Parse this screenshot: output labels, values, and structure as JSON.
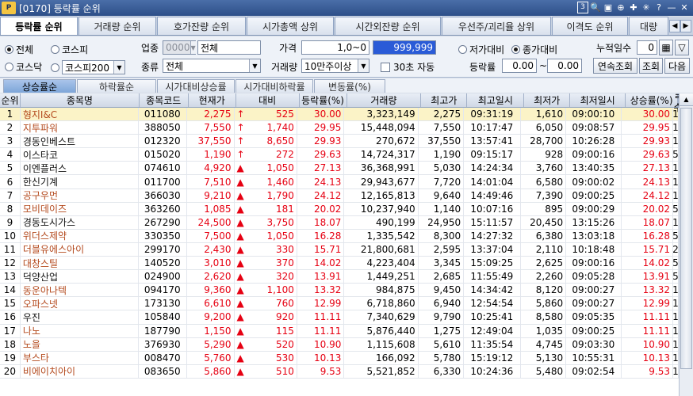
{
  "window": {
    "code": "[0170]",
    "title": "등락률 순위",
    "logo": "P"
  },
  "title_controls": [
    "3",
    "🔍",
    "▣",
    "⊕",
    "✚",
    "✳",
    "?",
    "—",
    "✕"
  ],
  "tabs": [
    "등락률 순위",
    "거래량 순위",
    "호가잔량 순위",
    "시가총액 상위",
    "시간외잔량 순위",
    "우선주/괴리율 상위",
    "이격도 순위",
    "대량"
  ],
  "filters": {
    "market_all": "전체",
    "kospi": "코스피",
    "kosdaq": "코스닥",
    "kospi200": "코스피200",
    "industry_label": "업종",
    "industry_code": "0000",
    "industry_name": "전체",
    "type_label": "종류",
    "type_value": "전체",
    "price_label": "가격",
    "price_from": "1,0~0",
    "price_to": "999,999",
    "volume_label": "거래량",
    "volume_value": "10만주이상",
    "auto30_label": "30초 자동",
    "vs_low": "저가대비",
    "vs_close": "종가대비",
    "rate_label": "등락률",
    "rate_from": "0.00",
    "rate_sep": "~",
    "rate_to": "0.00",
    "cum_days_label": "누적일수",
    "cum_days_value": "0",
    "continuous_btn": "연속조회",
    "query_btn": "조회",
    "next_btn": "다음"
  },
  "subtabs": [
    "상승률순",
    "하락률순",
    "시가대비상승률",
    "시가대비하락률",
    "변동률(%)"
  ],
  "columns": [
    "순위",
    "종목명",
    "종목코드",
    "현재가",
    "대비",
    "등락률(%)",
    "거래량",
    "최고가",
    "최고일시",
    "최저가",
    "최저일시",
    "상승률(%)",
    "일수"
  ],
  "rows": [
    [
      "1",
      "형지I&C",
      "011080",
      "2,275",
      "↑",
      "525",
      "30.00",
      "3,323,149",
      "2,275",
      "09:31:19",
      "1,610",
      "09:00:10",
      "30.00",
      "1"
    ],
    [
      "2",
      "지투파워",
      "388050",
      "7,550",
      "↑",
      "1,740",
      "29.95",
      "15,448,094",
      "7,550",
      "10:17:47",
      "6,050",
      "09:08:57",
      "29.95",
      "1"
    ],
    [
      "3",
      "경동인베스트",
      "012320",
      "37,550",
      "↑",
      "8,650",
      "29.93",
      "270,672",
      "37,550",
      "13:57:41",
      "28,700",
      "10:26:28",
      "29.93",
      "1"
    ],
    [
      "4",
      "이스타코",
      "015020",
      "1,190",
      "↑",
      "272",
      "29.63",
      "14,724,317",
      "1,190",
      "09:15:17",
      "928",
      "09:00:16",
      "29.63",
      "5"
    ],
    [
      "5",
      "이엔플러스",
      "074610",
      "4,920",
      "▲",
      "1,050",
      "27.13",
      "36,368,991",
      "5,030",
      "14:24:34",
      "3,760",
      "13:40:35",
      "27.13",
      "1"
    ],
    [
      "6",
      "한신기계",
      "011700",
      "7,510",
      "▲",
      "1,460",
      "24.13",
      "29,943,677",
      "7,720",
      "14:01:04",
      "6,580",
      "09:00:02",
      "24.13",
      "1"
    ],
    [
      "7",
      "공구우먼",
      "366030",
      "9,210",
      "▲",
      "1,790",
      "24.12",
      "12,165,813",
      "9,640",
      "14:49:46",
      "7,390",
      "09:00:25",
      "24.12",
      "1"
    ],
    [
      "8",
      "모비데이즈",
      "363260",
      "1,085",
      "▲",
      "181",
      "20.02",
      "10,237,940",
      "1,140",
      "10:07:16",
      "895",
      "09:00:29",
      "20.02",
      "5"
    ],
    [
      "9",
      "경동도시가스",
      "267290",
      "24,500",
      "▲",
      "3,750",
      "18.07",
      "490,199",
      "24,950",
      "15:11:57",
      "20,450",
      "13:15:26",
      "18.07",
      "1"
    ],
    [
      "10",
      "위더스제약",
      "330350",
      "7,500",
      "▲",
      "1,050",
      "16.28",
      "1,335,542",
      "8,300",
      "14:27:32",
      "6,380",
      "13:03:18",
      "16.28",
      "5"
    ],
    [
      "11",
      "더블유에스아이",
      "299170",
      "2,430",
      "▲",
      "330",
      "15.71",
      "21,800,681",
      "2,595",
      "13:37:04",
      "2,110",
      "10:18:48",
      "15.71",
      "2"
    ],
    [
      "12",
      "대창스틸",
      "140520",
      "3,010",
      "▲",
      "370",
      "14.02",
      "4,223,404",
      "3,345",
      "15:09:25",
      "2,625",
      "09:00:16",
      "14.02",
      "5"
    ],
    [
      "13",
      "덕양산업",
      "024900",
      "2,620",
      "▲",
      "320",
      "13.91",
      "1,449,251",
      "2,685",
      "11:55:49",
      "2,260",
      "09:05:28",
      "13.91",
      "5"
    ],
    [
      "14",
      "동운아나텍",
      "094170",
      "9,360",
      "▲",
      "1,100",
      "13.32",
      "984,875",
      "9,450",
      "14:34:42",
      "8,120",
      "09:00:27",
      "13.32",
      "1"
    ],
    [
      "15",
      "오파스넷",
      "173130",
      "6,610",
      "▲",
      "760",
      "12.99",
      "6,718,860",
      "6,940",
      "12:54:54",
      "5,860",
      "09:00:27",
      "12.99",
      "1"
    ],
    [
      "16",
      "우진",
      "105840",
      "9,200",
      "▲",
      "920",
      "11.11",
      "7,340,629",
      "9,790",
      "10:25:41",
      "8,580",
      "09:05:35",
      "11.11",
      "1"
    ],
    [
      "17",
      "나노",
      "187790",
      "1,150",
      "▲",
      "115",
      "11.11",
      "5,876,440",
      "1,275",
      "12:49:04",
      "1,035",
      "09:00:25",
      "11.11",
      "1"
    ],
    [
      "18",
      "노을",
      "376930",
      "5,290",
      "▲",
      "520",
      "10.90",
      "1,115,608",
      "5,610",
      "11:35:54",
      "4,745",
      "09:03:30",
      "10.90",
      "1"
    ],
    [
      "19",
      "부스타",
      "008470",
      "5,760",
      "▲",
      "530",
      "10.13",
      "166,092",
      "5,780",
      "15:19:12",
      "5,130",
      "10:55:31",
      "10.13",
      "1"
    ],
    [
      "20",
      "비에이치아이",
      "083650",
      "5,860",
      "▲",
      "510",
      "9.53",
      "5,521,852",
      "6,330",
      "10:24:36",
      "5,480",
      "09:02:54",
      "9.53",
      "1"
    ]
  ],
  "name_colors": [
    "red",
    "red",
    "blk",
    "blk",
    "blk",
    "blk",
    "red",
    "red",
    "blk",
    "red",
    "red",
    "red",
    "blk",
    "red",
    "red",
    "blk",
    "red",
    "red",
    "red",
    "red"
  ],
  "colors": {
    "up": "#e60012",
    "selected_row": "#fbf3c7",
    "title_bar": "#2d4f88"
  }
}
